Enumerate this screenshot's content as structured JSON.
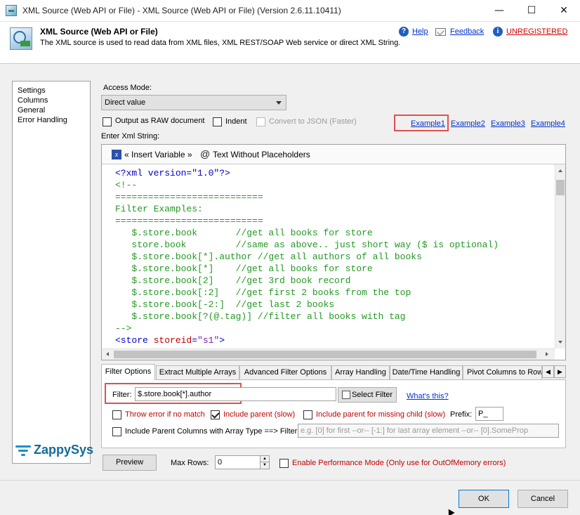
{
  "window": {
    "title": "XML Source (Web API or File) - XML Source (Web API or File) (Version 2.6.11.10411)"
  },
  "header": {
    "title": "XML Source (Web API or File)",
    "description": "The XML source is used to read data from XML files, XML REST/SOAP Web service or direct XML String.",
    "help_label": "Help",
    "feedback_label": "Feedback",
    "unregistered_label": "UNREGISTERED"
  },
  "nav": {
    "items": [
      "Settings",
      "Columns",
      "General",
      "Error Handling"
    ]
  },
  "logo": {
    "text": "ZappySys"
  },
  "settings": {
    "access_mode_label": "Access Mode:",
    "access_mode_value": "Direct value",
    "output_raw_label": "Output as RAW document",
    "indent_label": "Indent",
    "convert_json_label": "Convert to JSON (Faster)",
    "examples": [
      "Example1",
      "Example2",
      "Example3",
      "Example4"
    ],
    "enter_xml_label": "Enter Xml String:"
  },
  "editor": {
    "insert_variable_label": "« Insert Variable »",
    "text_without_placeholders_label": "Text Without Placeholders",
    "lines": {
      "l1": "<?xml version=\"1.0\"?>",
      "l2": "<!--",
      "l3": "===========================",
      "l4": "Filter Examples:",
      "l5": "===========================",
      "l6": "   $.store.book       //get all books for store",
      "l7": "   store.book         //same as above.. just short way ($ is optional)",
      "l8": "   $.store.book[*].author //get all authors of all books",
      "l9": "   $.store.book[*]    //get all books for store",
      "l10": "   $.store.book[2]    //get 3rd book record",
      "l11": "   $.store.book[:2]   //get first 2 books from the top",
      "l12": "   $.store.book[-2:]  //get last 2 books",
      "l13": "   $.store.book[?(@.tag)] //filter all books with tag",
      "l14": "-->",
      "l15_tag": "<store",
      "l15_attr": " storeid",
      "l15_eq": "=",
      "l15_val": "\"s1\"",
      "l15_end": ">"
    }
  },
  "tabs": [
    "Filter Options",
    "Extract Multiple Arrays",
    "Advanced Filter Options",
    "Array Handling",
    "Date/Time Handling",
    "Pivot Columns to Rows"
  ],
  "filter_options": {
    "filter_label": "Filter:",
    "filter_value": "$.store.book[*].author",
    "select_filter_label": "Select Filter",
    "whats_this_label": "What's this?",
    "throw_error_label": "Throw error if no match",
    "include_parent_label": "Include parent (slow)",
    "include_parent_missing_label": "Include parent for missing child (slow)",
    "prefix_label": "Prefix:",
    "prefix_value": "P_",
    "include_parent_columns_label": "Include Parent Columns with Array Type ==> Filter :",
    "array_filter_placeholder": "e.g. [0] for first --or-- [-1:] for last array element --or-- [0].SomeProp"
  },
  "bottom": {
    "preview_label": "Preview",
    "max_rows_label": "Max Rows:",
    "max_rows_value": "0",
    "perf_mode_label": "Enable Performance Mode (Only use for OutOfMemory errors)",
    "ok_label": "OK",
    "cancel_label": "Cancel"
  }
}
